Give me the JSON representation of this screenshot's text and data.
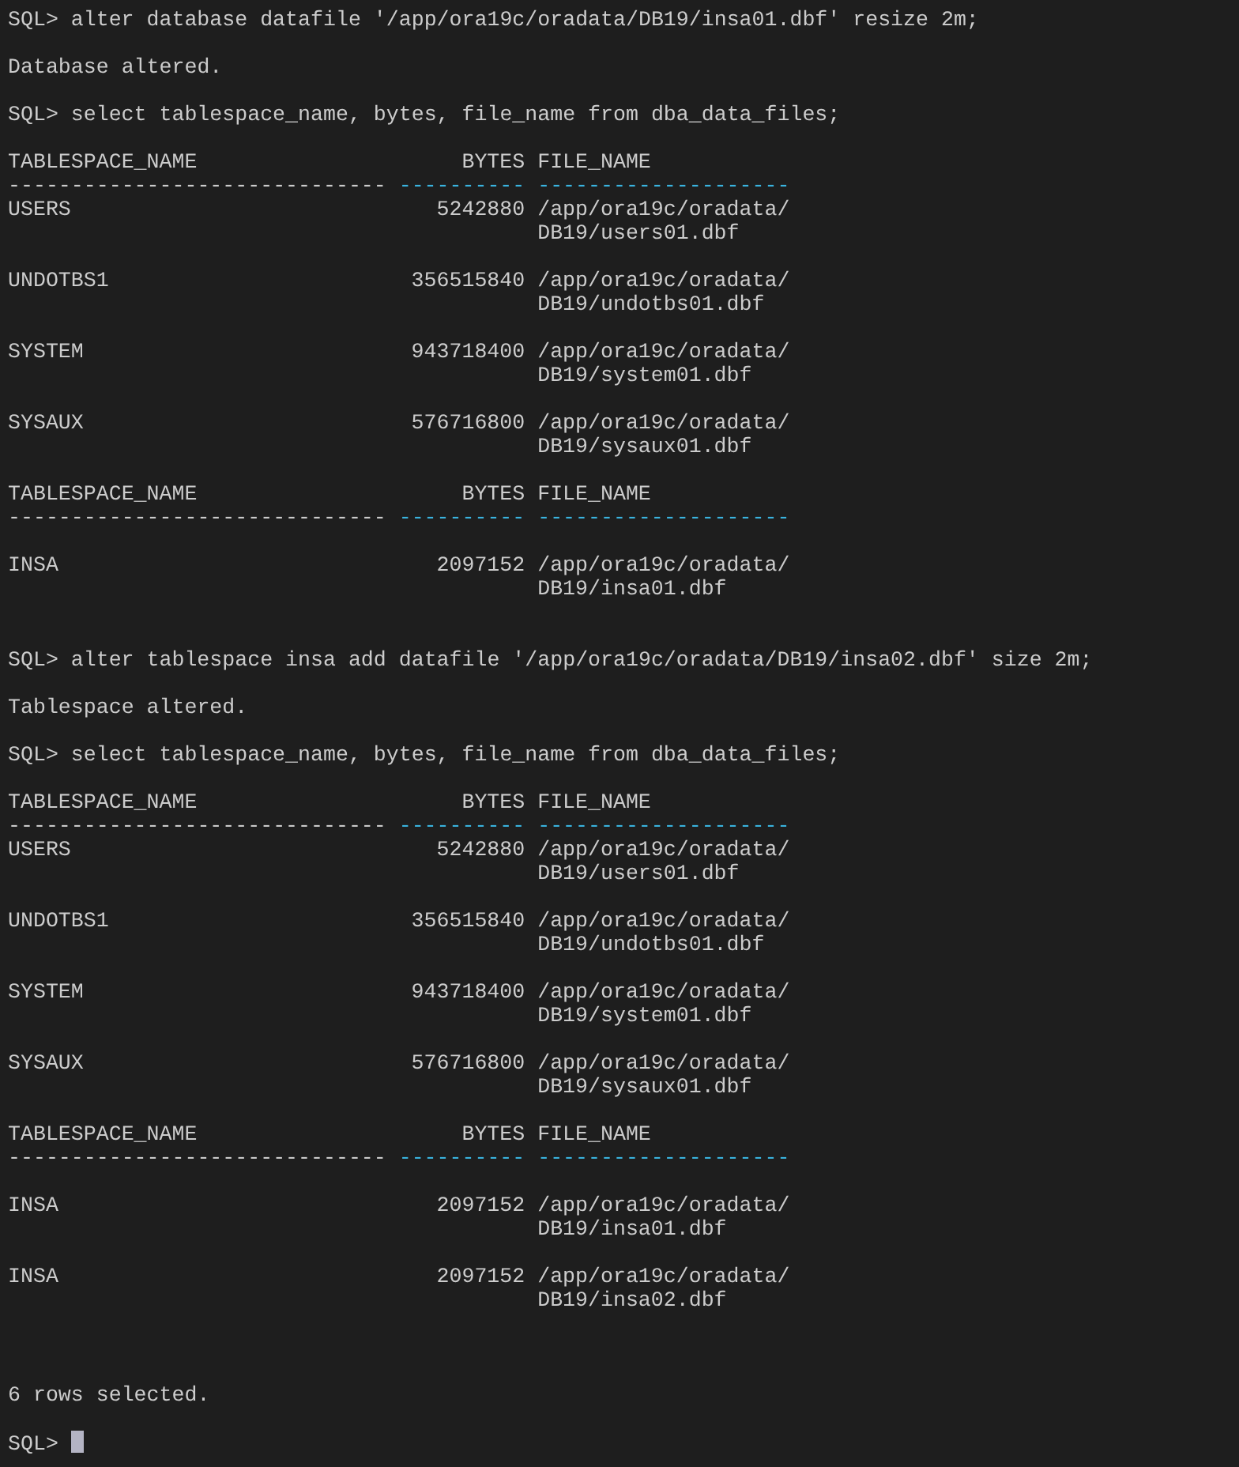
{
  "lines": [
    {
      "kind": "command",
      "prompt": "SQL>",
      "text": "alter database datafile '/app/ora19c/oradata/DB19/insa01.dbf' resize 2m;"
    },
    {
      "kind": "blank"
    },
    {
      "kind": "output",
      "text": "Database altered."
    },
    {
      "kind": "blank"
    },
    {
      "kind": "command",
      "prompt": "SQL>",
      "text": "select tablespace_name, bytes, file_name from dba_data_files;"
    },
    {
      "kind": "blank"
    },
    {
      "kind": "header",
      "columns": [
        "TABLESPACE_NAME",
        "BYTES",
        "FILE_NAME"
      ]
    },
    {
      "kind": "separator",
      "segments": [
        {
          "text": "------------------------------",
          "highlighted": false
        },
        {
          "text": "----------",
          "highlighted": true
        },
        {
          "text": "--------------------",
          "highlighted": true
        }
      ]
    },
    {
      "kind": "row",
      "cells": [
        "USERS",
        "5242880"
      ],
      "file_lines": [
        "/app/ora19c/oradata/",
        "DB19/users01.dbf"
      ]
    },
    {
      "kind": "blank"
    },
    {
      "kind": "row",
      "cells": [
        "UNDOTBS1",
        "356515840"
      ],
      "file_lines": [
        "/app/ora19c/oradata/",
        "DB19/undotbs01.dbf"
      ]
    },
    {
      "kind": "blank"
    },
    {
      "kind": "row",
      "cells": [
        "SYSTEM",
        "943718400"
      ],
      "file_lines": [
        "/app/ora19c/oradata/",
        "DB19/system01.dbf"
      ]
    },
    {
      "kind": "blank"
    },
    {
      "kind": "row",
      "cells": [
        "SYSAUX",
        "576716800"
      ],
      "file_lines": [
        "/app/ora19c/oradata/",
        "DB19/sysaux01.dbf"
      ]
    },
    {
      "kind": "blank"
    },
    {
      "kind": "header",
      "columns": [
        "TABLESPACE_NAME",
        "BYTES",
        "FILE_NAME"
      ]
    },
    {
      "kind": "separator",
      "segments": [
        {
          "text": "------------------------------",
          "highlighted": false
        },
        {
          "text": "----------",
          "highlighted": true
        },
        {
          "text": "--------------------",
          "highlighted": true
        }
      ]
    },
    {
      "kind": "blank"
    },
    {
      "kind": "row",
      "cells": [
        "INSA",
        "2097152"
      ],
      "file_lines": [
        "/app/ora19c/oradata/",
        "DB19/insa01.dbf"
      ]
    },
    {
      "kind": "blank"
    },
    {
      "kind": "blank"
    },
    {
      "kind": "command",
      "prompt": "SQL>",
      "text": "alter tablespace insa add datafile '/app/ora19c/oradata/DB19/insa02.dbf' size 2m;"
    },
    {
      "kind": "blank"
    },
    {
      "kind": "output",
      "text": "Tablespace altered."
    },
    {
      "kind": "blank"
    },
    {
      "kind": "command",
      "prompt": "SQL>",
      "text": "select tablespace_name, bytes, file_name from dba_data_files;"
    },
    {
      "kind": "blank"
    },
    {
      "kind": "header",
      "columns": [
        "TABLESPACE_NAME",
        "BYTES",
        "FILE_NAME"
      ]
    },
    {
      "kind": "separator",
      "segments": [
        {
          "text": "------------------------------",
          "highlighted": false
        },
        {
          "text": "----------",
          "highlighted": true
        },
        {
          "text": "--------------------",
          "highlighted": true
        }
      ]
    },
    {
      "kind": "row",
      "cells": [
        "USERS",
        "5242880"
      ],
      "file_lines": [
        "/app/ora19c/oradata/",
        "DB19/users01.dbf"
      ]
    },
    {
      "kind": "blank"
    },
    {
      "kind": "row",
      "cells": [
        "UNDOTBS1",
        "356515840"
      ],
      "file_lines": [
        "/app/ora19c/oradata/",
        "DB19/undotbs01.dbf"
      ]
    },
    {
      "kind": "blank"
    },
    {
      "kind": "row",
      "cells": [
        "SYSTEM",
        "943718400"
      ],
      "file_lines": [
        "/app/ora19c/oradata/",
        "DB19/system01.dbf"
      ]
    },
    {
      "kind": "blank"
    },
    {
      "kind": "row",
      "cells": [
        "SYSAUX",
        "576716800"
      ],
      "file_lines": [
        "/app/ora19c/oradata/",
        "DB19/sysaux01.dbf"
      ]
    },
    {
      "kind": "blank"
    },
    {
      "kind": "header",
      "columns": [
        "TABLESPACE_NAME",
        "BYTES",
        "FILE_NAME"
      ]
    },
    {
      "kind": "separator",
      "segments": [
        {
          "text": "------------------------------",
          "highlighted": false
        },
        {
          "text": "----------",
          "highlighted": true
        },
        {
          "text": "--------------------",
          "highlighted": true
        }
      ]
    },
    {
      "kind": "blank"
    },
    {
      "kind": "row",
      "cells": [
        "INSA",
        "2097152"
      ],
      "file_lines": [
        "/app/ora19c/oradata/",
        "DB19/insa01.dbf"
      ]
    },
    {
      "kind": "blank"
    },
    {
      "kind": "row",
      "cells": [
        "INSA",
        "2097152"
      ],
      "file_lines": [
        "/app/ora19c/oradata/",
        "DB19/insa02.dbf"
      ]
    },
    {
      "kind": "blank"
    },
    {
      "kind": "blank"
    },
    {
      "kind": "blank"
    },
    {
      "kind": "output",
      "text": "6 rows selected."
    },
    {
      "kind": "blank"
    },
    {
      "kind": "command",
      "prompt": "SQL>",
      "cursor": true
    }
  ]
}
